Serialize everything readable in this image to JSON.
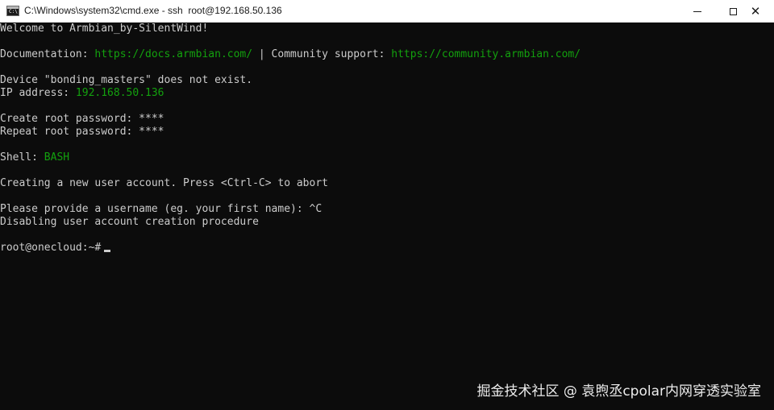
{
  "window": {
    "title": "C:\\Windows\\system32\\cmd.exe - ssh  root@192.168.50.136",
    "icon": "cmd-icon",
    "minimize": "minimize-icon",
    "maximize": "maximize-icon",
    "close": "close-icon"
  },
  "colors": {
    "background": "#0c0c0c",
    "text": "#cccccc",
    "highlight": "#13a10e"
  },
  "terminal": {
    "welcome": "Welcome to Armbian_by-SilentWind!",
    "doc_label": "Documentation: ",
    "doc_url": "https://docs.armbian.com/",
    "doc_sep": " | Community support: ",
    "community_url": "https://community.armbian.com/",
    "device_msg": "Device \"bonding_masters\" does not exist.",
    "ip_label": "IP address: ",
    "ip_value": "192.168.50.136",
    "create_pw": "Create root password: ****",
    "repeat_pw": "Repeat root password: ****",
    "shell_label": "Shell: ",
    "shell_value": "BASH",
    "creating_user": "Creating a new user account. Press <Ctrl-C> to abort",
    "username_prompt": "Please provide a username (eg. your first name): ^C",
    "disabling": "Disabling user account creation procedure",
    "prompt": "root@onecloud:~#"
  },
  "watermark": "掘金技术社区 @ 袁煦丞cpolar内网穿透实验室"
}
